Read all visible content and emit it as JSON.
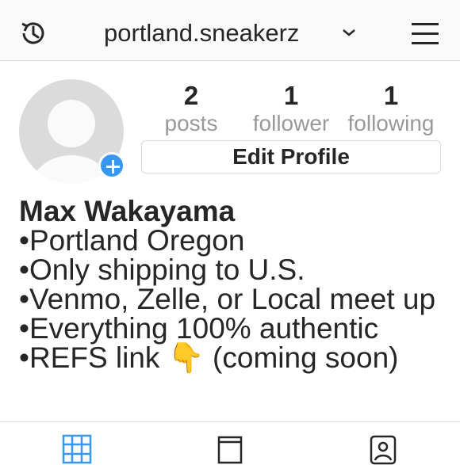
{
  "header": {
    "username": "portland.sneakerz",
    "history_icon": "history-clock-icon",
    "dropdown_icon": "chevron-down-icon",
    "menu_icon": "hamburger-menu-icon"
  },
  "profile": {
    "avatar_icon": "default-avatar-icon",
    "add_story_icon": "plus-icon",
    "stats": [
      {
        "count": "2",
        "label": "posts"
      },
      {
        "count": "1",
        "label": "follower"
      },
      {
        "count": "1",
        "label": "following"
      }
    ],
    "edit_profile_label": "Edit Profile"
  },
  "bio": {
    "name": "Max Wakayama",
    "lines": [
      "•Portland Oregon",
      "•Only shipping to U.S.",
      "•Venmo, Zelle, or Local meet up",
      "•Everything 100% authentic",
      "•REFS link 👇 (coming soon)"
    ]
  },
  "tabs": [
    {
      "icon": "grid-icon",
      "active": true
    },
    {
      "icon": "feed-icon",
      "active": false
    },
    {
      "icon": "tagged-icon",
      "active": false
    }
  ],
  "colors": {
    "accent": "#3897f0",
    "text": "#262626",
    "muted": "#999999",
    "border": "#dbdbdb"
  }
}
